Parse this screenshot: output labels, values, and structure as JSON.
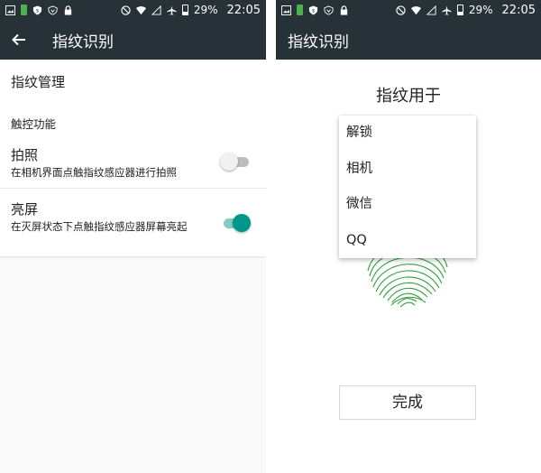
{
  "status_bar": {
    "battery_percent": "29%",
    "time": "22:05",
    "icons": [
      "image-icon",
      "battery-charging-icon",
      "shield-icon",
      "shield-outline-icon",
      "lock-icon",
      "do-not-disturb-icon",
      "wifi-icon",
      "signal-off-icon",
      "airplane-icon",
      "battery-icon"
    ]
  },
  "left_screen": {
    "title": "指纹识别",
    "items": {
      "fingerprint_management": "指纹管理",
      "touch_section_header": "触控功能",
      "photo": {
        "title": "拍照",
        "subtitle": "在相机界面点触指纹感应器进行拍照",
        "enabled": false
      },
      "screen_on": {
        "title": "亮屏",
        "subtitle": "在灭屏状态下点触指纹感应器屏幕亮起",
        "enabled": true
      }
    }
  },
  "right_screen": {
    "title": "指纹识别",
    "uses_title": "指纹用于",
    "dropdown_options": [
      "解锁",
      "相机",
      "微信",
      "QQ"
    ],
    "done_button": "完成",
    "fingerprint_color": "#2e9e3a"
  },
  "colors": {
    "toolbar": "#263238",
    "accent": "#009688",
    "fingerprint": "#2e9e3a"
  }
}
